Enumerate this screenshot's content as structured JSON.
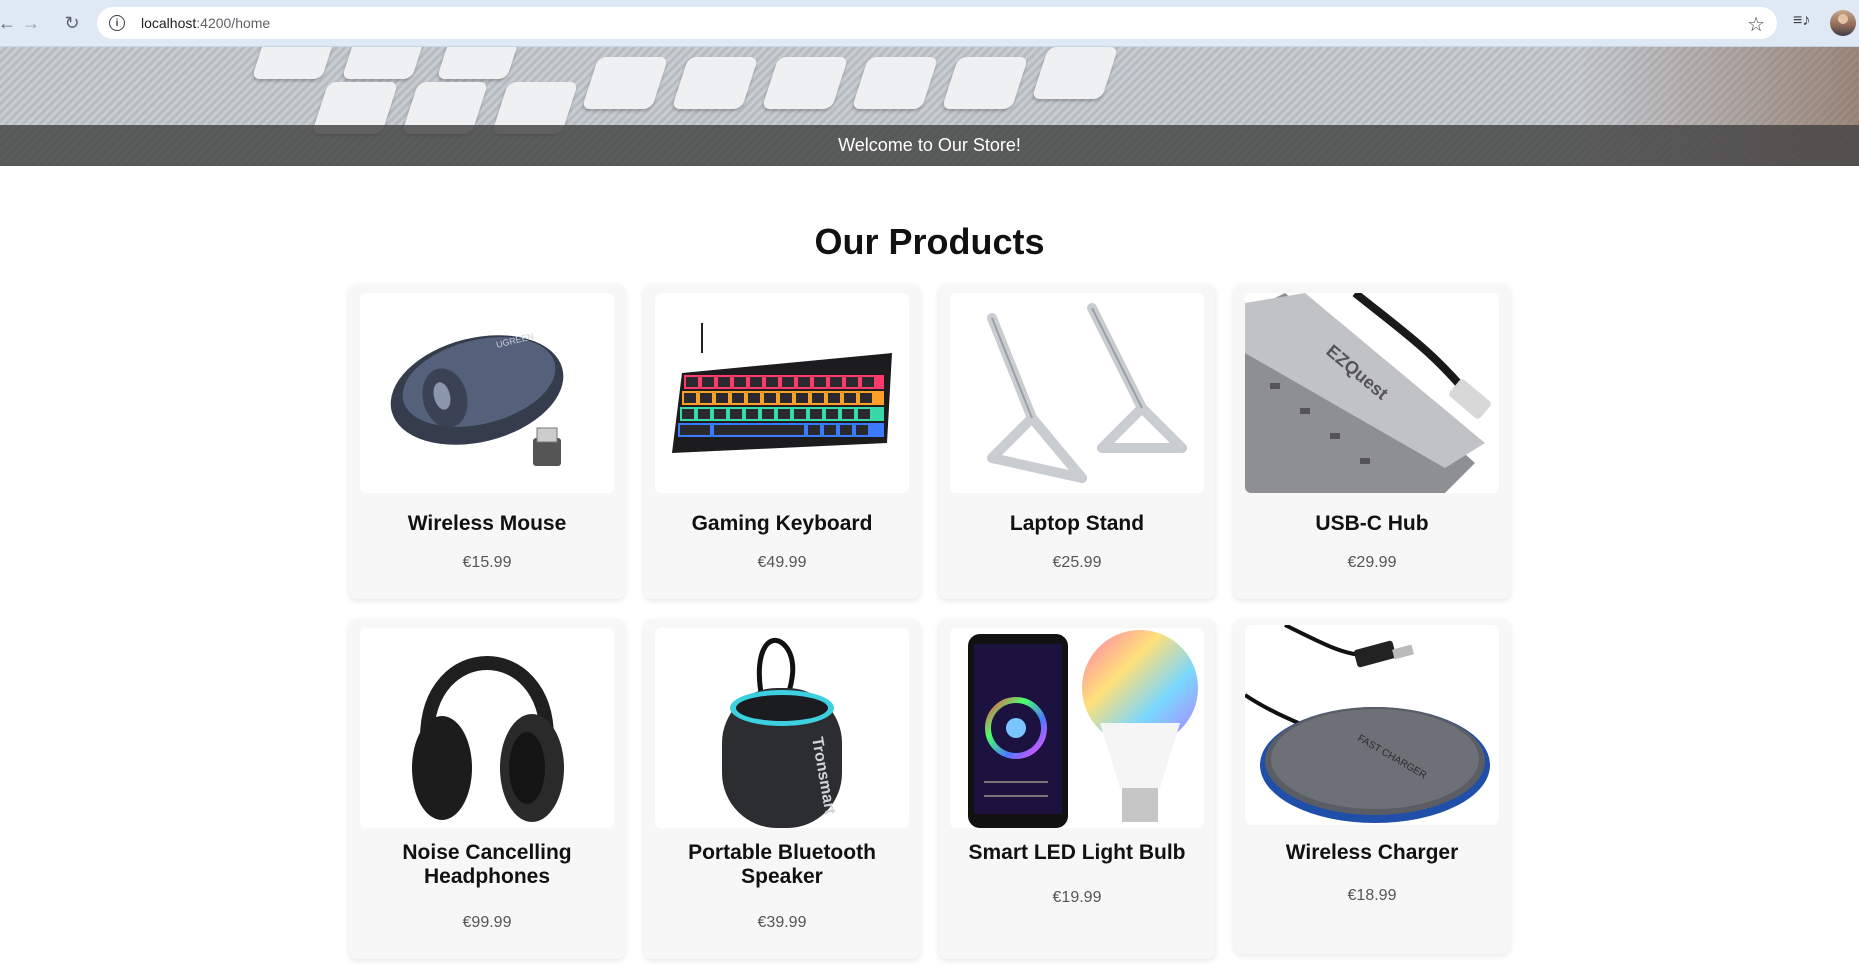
{
  "browser": {
    "url_host": "localhost",
    "url_path": ":4200/home"
  },
  "hero": {
    "caption": "Welcome to Our Store!"
  },
  "products_section": {
    "title": "Our Products",
    "items": [
      {
        "name": "Wireless Mouse",
        "price": "€15.99",
        "icon": "mouse-image"
      },
      {
        "name": "Gaming Keyboard",
        "price": "€49.99",
        "icon": "keyboard-image"
      },
      {
        "name": "Laptop Stand",
        "price": "€25.99",
        "icon": "laptop-stand-image"
      },
      {
        "name": "USB-C Hub",
        "price": "€29.99",
        "icon": "usb-hub-image"
      },
      {
        "name": "Noise Cancelling Headphones",
        "price": "€99.99",
        "icon": "headphones-image"
      },
      {
        "name": "Portable Bluetooth Speaker",
        "price": "€39.99",
        "icon": "speaker-image"
      },
      {
        "name": "Smart LED Light Bulb",
        "price": "€19.99",
        "icon": "light-bulb-image"
      },
      {
        "name": "Wireless Charger",
        "price": "€18.99",
        "icon": "charger-image"
      }
    ]
  },
  "product_image_labels": {
    "mouse_brand": "UGREEN",
    "usb_hub_brand": "EZQuest",
    "speaker_brand": "Tronsmart",
    "charger_label": "FAST CHARGER"
  }
}
